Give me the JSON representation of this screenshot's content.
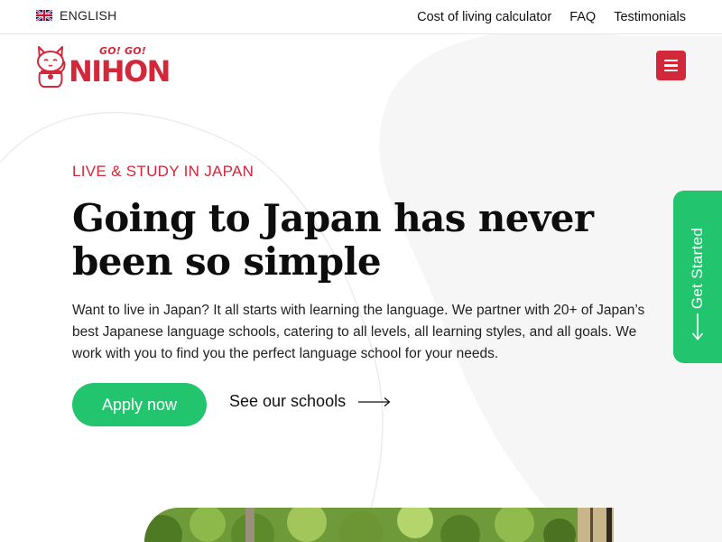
{
  "topbar": {
    "language": {
      "label": "ENGLISH",
      "flag_icon": "uk-flag-icon"
    },
    "links": [
      "Cost of living calculator",
      "FAQ",
      "Testimonials"
    ]
  },
  "header": {
    "logo": {
      "small_text": "GO! GO!",
      "main_text": "NIHON",
      "icon": "maneki-neko-cat-icon"
    },
    "menu_icon": "hamburger-menu-icon"
  },
  "hero": {
    "eyebrow": "LIVE & STUDY IN JAPAN",
    "headline": "Going to Japan has never been so simple",
    "description": "Want to live in Japan? It all starts with learning the language. We partner with 20+ of Japan’s best Japanese language schools, catering to all levels, all learning styles, and all goals. We work with you to find you the perfect language school for your needs.",
    "primary_button": "Apply now",
    "secondary_link": "See our schools",
    "secondary_icon": "long-arrow-right-icon"
  },
  "side_tab": {
    "label": "Get Started",
    "icon": "arrow-down-icon"
  },
  "colors": {
    "brand_red": "#d2283a",
    "accent_green": "#22c46e",
    "text": "#1a1a1a"
  }
}
